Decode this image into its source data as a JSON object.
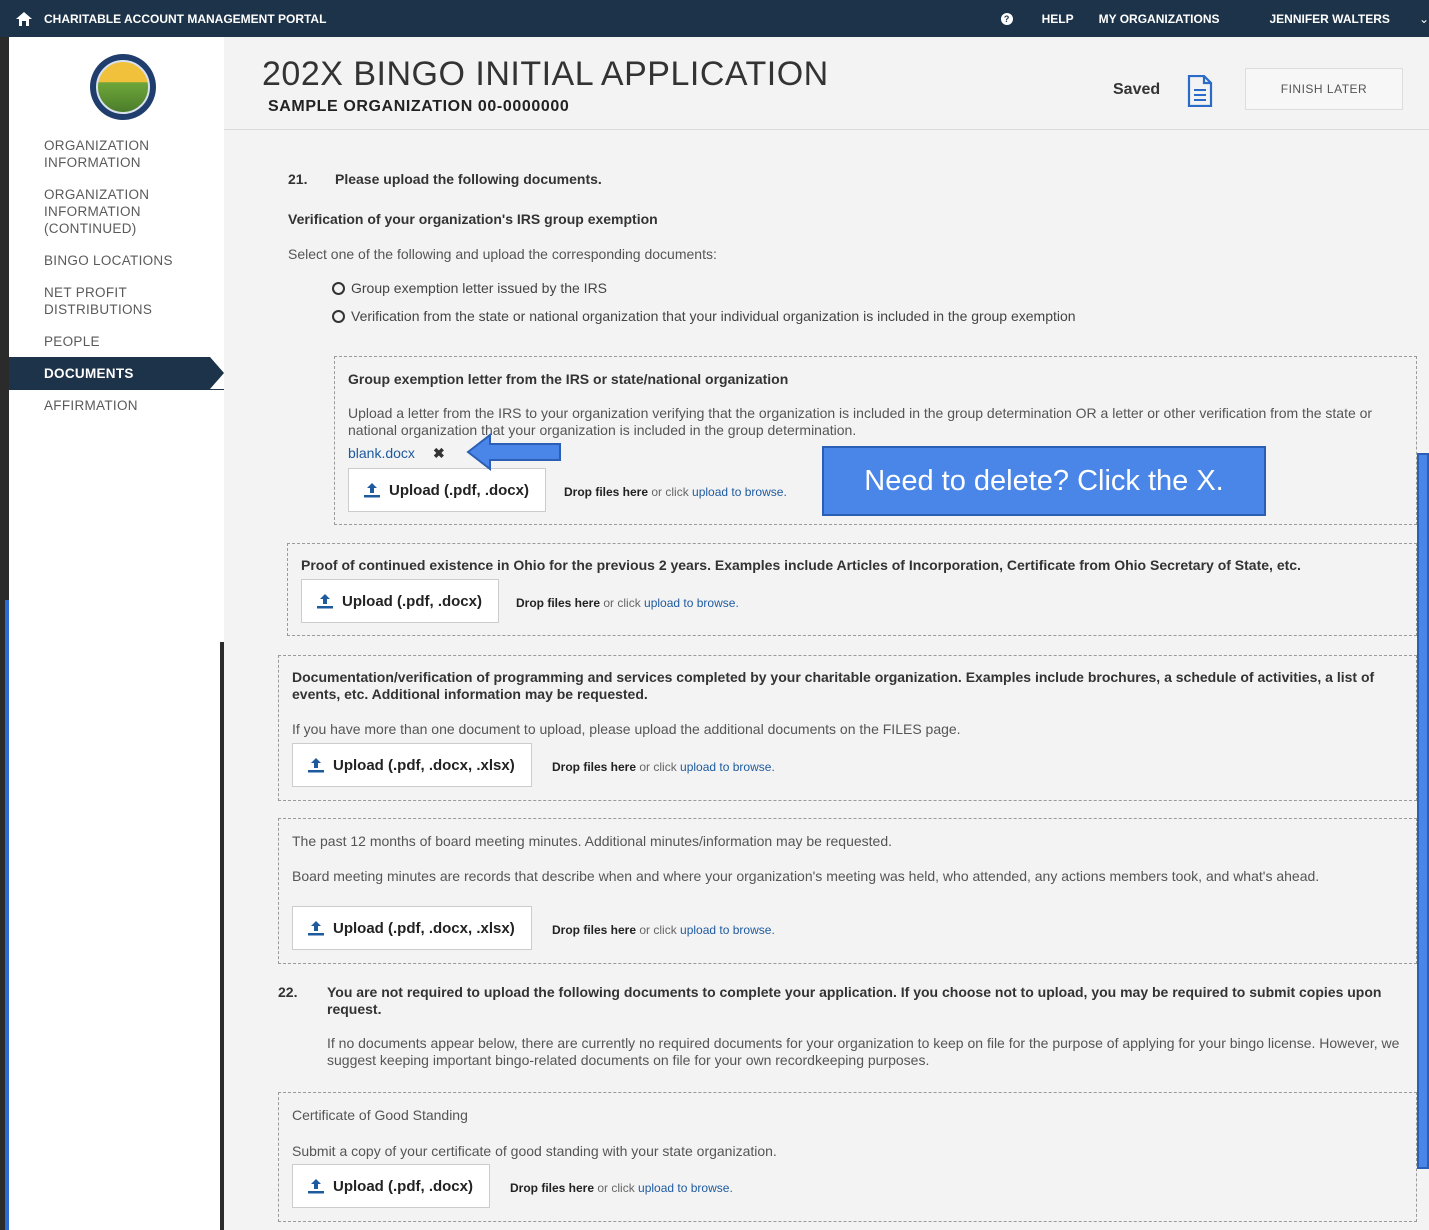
{
  "topbar": {
    "app_title": "CHARITABLE ACCOUNT MANAGEMENT PORTAL",
    "help": "HELP",
    "my_orgs": "MY ORGANIZATIONS",
    "user": "JENNIFER WALTERS"
  },
  "sidebar": {
    "items": [
      {
        "label": "ORGANIZATION INFORMATION"
      },
      {
        "label": "ORGANIZATION INFORMATION (CONTINUED)"
      },
      {
        "label": "BINGO LOCATIONS"
      },
      {
        "label": "NET PROFIT DISTRIBUTIONS"
      },
      {
        "label": "PEOPLE"
      },
      {
        "label": "DOCUMENTS"
      },
      {
        "label": "AFFIRMATION"
      }
    ]
  },
  "header": {
    "title": "202X BINGO INITIAL APPLICATION",
    "org": "SAMPLE ORGANIZATION 00-0000000",
    "saved": "Saved",
    "finish_later": "FINISH LATER"
  },
  "q21": {
    "number": "21.",
    "title": "Please upload the following documents.",
    "subheading": "Verification of your organization's IRS group exemption",
    "instructions": "Select one of the following and upload the corresponding documents:",
    "options": [
      "Group exemption letter issued by the IRS",
      "Verification from the state or national organization that your individual organization is included in the group exemption"
    ]
  },
  "doc1": {
    "title": "Group exemption letter from the IRS or state/national organization",
    "desc": "Upload a letter from the IRS to your organization verifying that the organization is included in the group determination OR a letter or other verification from the state or national organization that your organization is included in the group determination.",
    "file": "blank.docx",
    "upload": "Upload (.pdf, .docx)"
  },
  "doc2": {
    "title": "Proof of continued existence in Ohio for the previous 2 years. Examples include Articles of Incorporation, Certificate from Ohio Secretary of State, etc.",
    "upload": "Upload (.pdf, .docx)"
  },
  "doc3": {
    "title": "Documentation/verification of programming and services completed by your charitable organization. Examples include brochures, a schedule of activities, a list of events, etc. Additional information may be requested.",
    "desc": "If you have more than one document to upload, please upload the additional documents on the FILES page.",
    "upload": "Upload (.pdf, .docx, .xlsx)"
  },
  "doc4": {
    "title": "The past 12 months of board meeting minutes. Additional minutes/information may be requested.",
    "desc": "Board meeting minutes are records that describe when and where your organization's meeting was held, who attended, any actions members took, and what's ahead.",
    "upload": "Upload (.pdf, .docx, .xlsx)"
  },
  "q22": {
    "number": "22.",
    "title": "You are not required to upload the following documents to complete your application. If you choose not to upload, you may be required to submit copies upon request.",
    "desc": "If no documents appear below, there are currently no required documents for your organization to keep on file for the purpose of applying for your bingo license. However, we suggest keeping important bingo-related documents on file for your own recordkeeping purposes."
  },
  "doc5": {
    "title": "Certificate of Good Standing",
    "desc": "Submit a copy of your certificate of good standing with your state organization.",
    "upload": "Upload (.pdf, .docx)"
  },
  "dropzone": {
    "drop": "Drop files here",
    "or_click": " or click ",
    "browse": "upload to browse."
  },
  "callout": {
    "text": "Need to delete? Click the X."
  },
  "colors": {
    "nav": "#1d3349",
    "link": "#1e5a9e",
    "callout": "#4a86e8"
  }
}
